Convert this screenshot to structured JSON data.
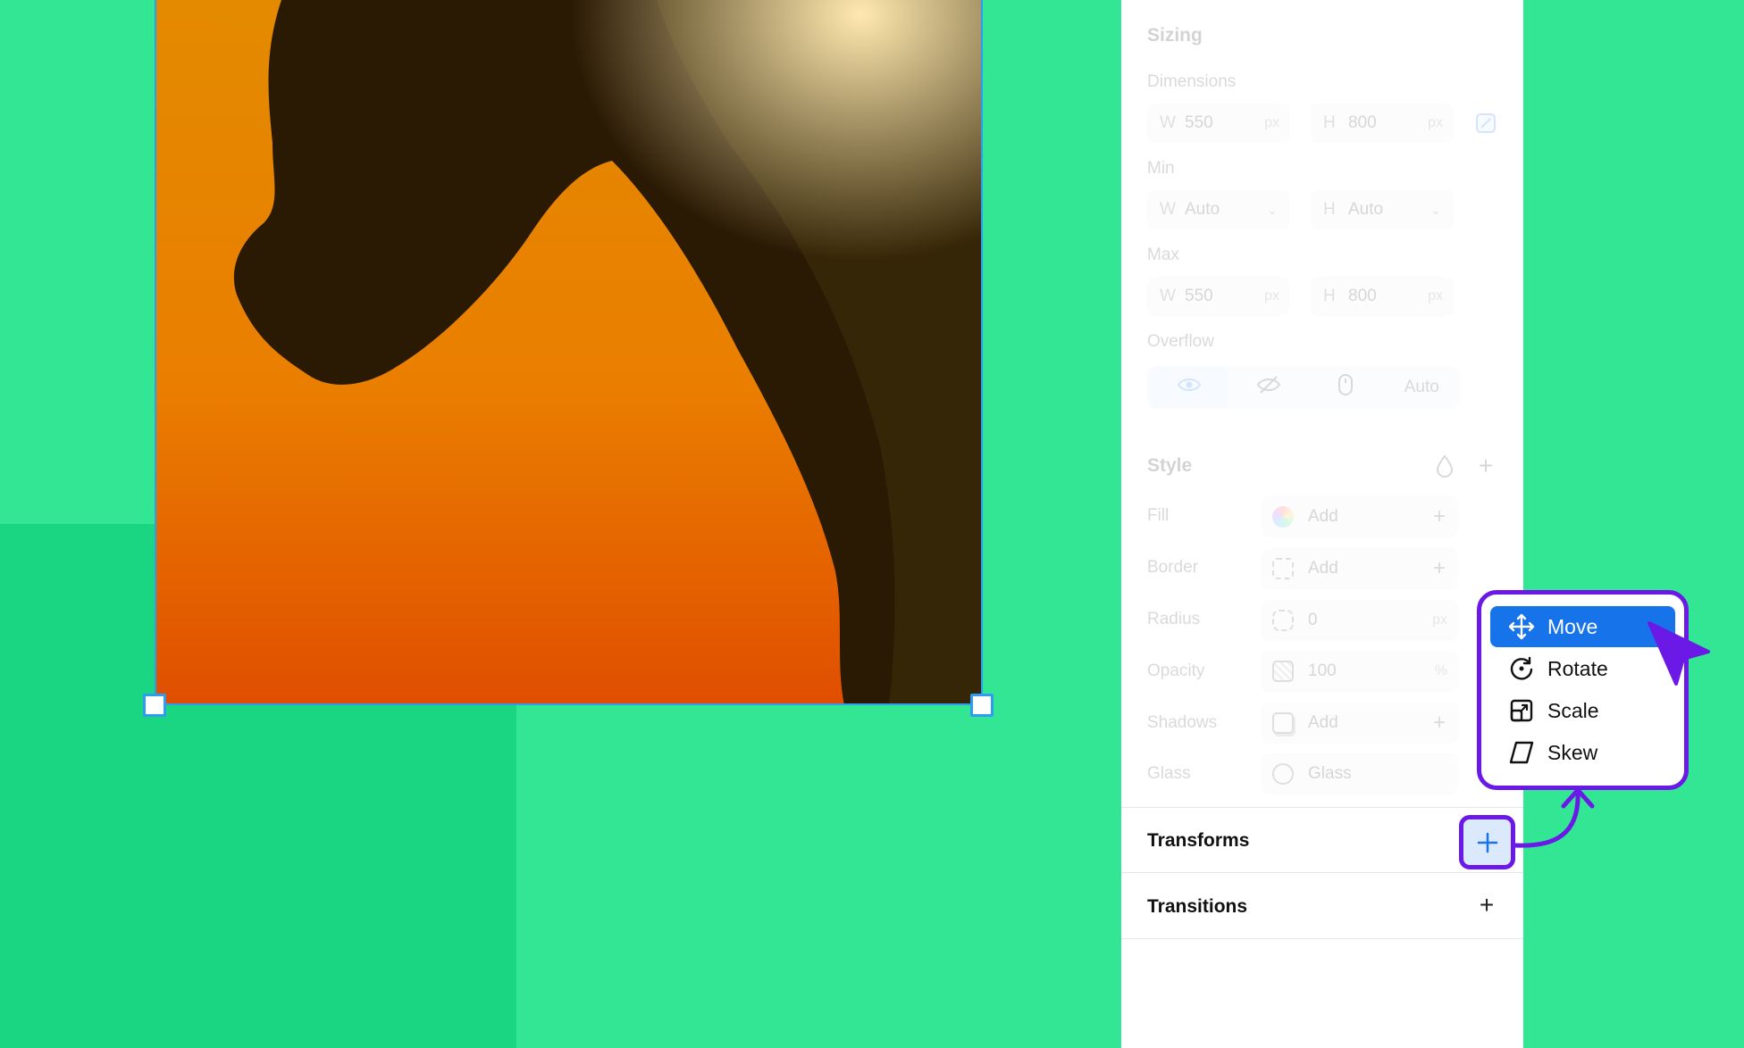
{
  "panel": {
    "sizing": {
      "title": "Sizing",
      "dimensions_label": "Dimensions",
      "width": {
        "prefix": "W",
        "value": "550",
        "unit": "px"
      },
      "height": {
        "prefix": "H",
        "value": "800",
        "unit": "px"
      },
      "min_label": "Min",
      "min_width": {
        "prefix": "W",
        "value": "Auto"
      },
      "min_height": {
        "prefix": "H",
        "value": "Auto"
      },
      "max_label": "Max",
      "max_width": {
        "prefix": "W",
        "value": "550",
        "unit": "px"
      },
      "max_height": {
        "prefix": "H",
        "value": "800",
        "unit": "px"
      },
      "overflow_label": "Overflow",
      "overflow_auto": "Auto"
    },
    "style": {
      "title": "Style",
      "fill": {
        "label": "Fill",
        "value": "Add"
      },
      "border": {
        "label": "Border",
        "value": "Add"
      },
      "radius": {
        "label": "Radius",
        "value": "0",
        "unit": "px"
      },
      "opacity": {
        "label": "Opacity",
        "value": "100",
        "unit": "%"
      },
      "shadows": {
        "label": "Shadows",
        "value": "Add"
      },
      "glass": {
        "label": "Glass",
        "value": "Glass"
      }
    },
    "transforms": {
      "title": "Transforms"
    },
    "transitions": {
      "title": "Transitions"
    }
  },
  "menu": {
    "items": [
      {
        "label": "Move",
        "icon": "move-icon",
        "active": true
      },
      {
        "label": "Rotate",
        "icon": "rotate-icon",
        "active": false
      },
      {
        "label": "Scale",
        "icon": "scale-icon",
        "active": false
      },
      {
        "label": "Skew",
        "icon": "skew-icon",
        "active": false
      }
    ]
  },
  "colors": {
    "canvas": "#33e694",
    "selection": "#2f9cf0",
    "highlight": "#6a19e6",
    "menu_active": "#1673ea"
  }
}
